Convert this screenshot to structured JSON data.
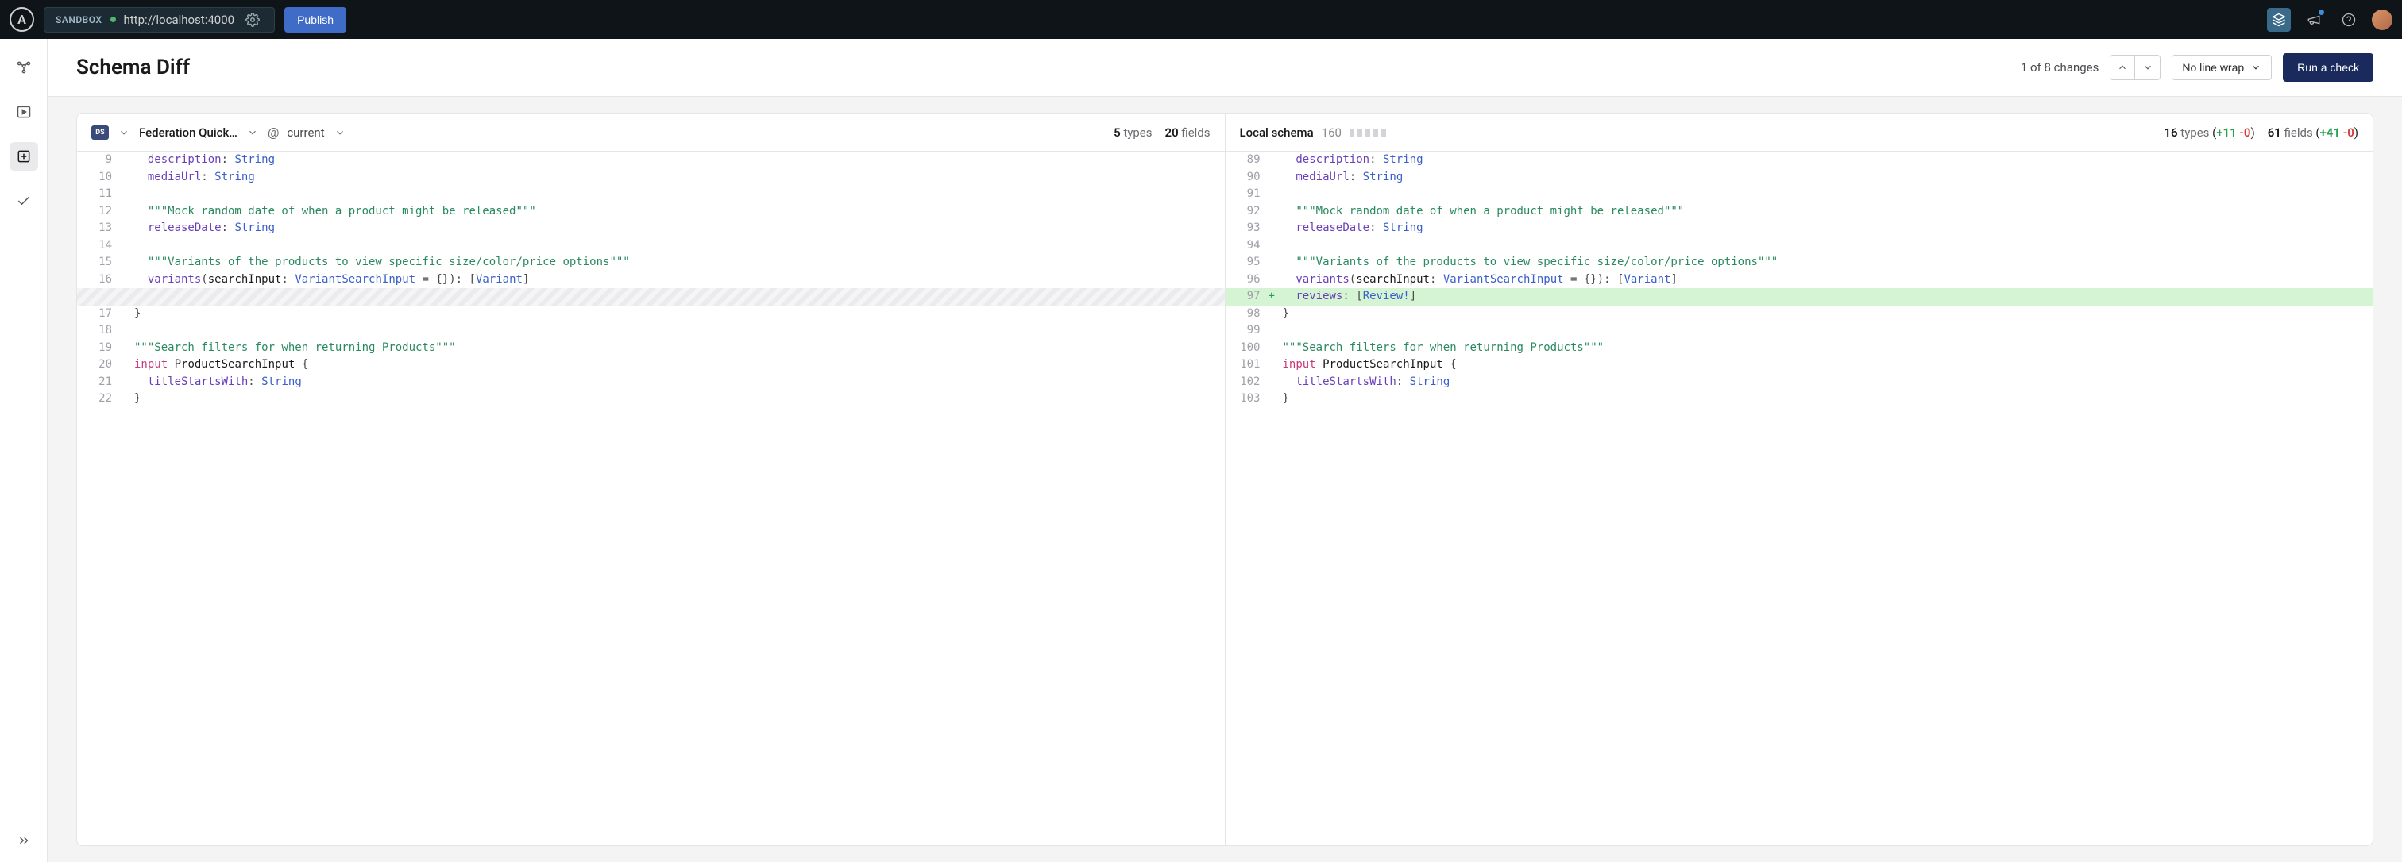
{
  "topbar": {
    "logo": "A",
    "sandbox_label": "SANDBOX",
    "url": "http://localhost:4000",
    "publish": "Publish"
  },
  "page": {
    "title": "Schema Diff",
    "changes_text": "1 of 8 changes",
    "wrap_label": "No line wrap",
    "run_check": "Run a check"
  },
  "left_col": {
    "ds_label": "DS",
    "graph_name": "Federation Quick…",
    "variant": "current",
    "types_count": "5",
    "types_label": "types",
    "fields_count": "20",
    "fields_label": "fields",
    "lines": [
      {
        "n": "9",
        "indent": "  ",
        "field": "description",
        "type": "String"
      },
      {
        "n": "10",
        "indent": "  ",
        "field": "mediaUrl",
        "type": "String"
      },
      {
        "n": "11",
        "blank": true
      },
      {
        "n": "12",
        "indent": "  ",
        "comment": "\"\"\"Mock random date of when a product might be released\"\"\""
      },
      {
        "n": "13",
        "indent": "  ",
        "field": "releaseDate",
        "type": "String"
      },
      {
        "n": "14",
        "blank": true
      },
      {
        "n": "15",
        "indent": "  ",
        "comment": "\"\"\"Variants of the products to view specific size/color/price options\"\"\""
      },
      {
        "n": "16",
        "indent": "  ",
        "variants": true
      },
      {
        "hatched": true
      },
      {
        "n": "17",
        "close": "}"
      },
      {
        "n": "18",
        "blank": true
      },
      {
        "n": "19",
        "comment": "\"\"\"Search filters for when returning Products\"\"\""
      },
      {
        "n": "20",
        "input_def": "ProductSearchInput"
      },
      {
        "n": "21",
        "indent": "  ",
        "field": "titleStartsWith",
        "type": "String"
      },
      {
        "n": "22",
        "close": "}"
      }
    ]
  },
  "right_col": {
    "title": "Local schema",
    "line_count": "160",
    "types_count": "16",
    "types_label": "types",
    "types_add": "+11",
    "types_del": "-0",
    "fields_count": "61",
    "fields_label": "fields",
    "fields_add": "+41",
    "fields_del": "-0",
    "lines": [
      {
        "n": "89",
        "indent": "  ",
        "field": "description",
        "type": "String"
      },
      {
        "n": "90",
        "indent": "  ",
        "field": "mediaUrl",
        "type": "String"
      },
      {
        "n": "91",
        "blank": true
      },
      {
        "n": "92",
        "indent": "  ",
        "comment": "\"\"\"Mock random date of when a product might be released\"\"\""
      },
      {
        "n": "93",
        "indent": "  ",
        "field": "releaseDate",
        "type": "String"
      },
      {
        "n": "94",
        "blank": true
      },
      {
        "n": "95",
        "indent": "  ",
        "comment": "\"\"\"Variants of the products to view specific size/color/price options\"\"\""
      },
      {
        "n": "96",
        "indent": "  ",
        "variants": true
      },
      {
        "n": "97",
        "mark": "+",
        "added": true,
        "indent": "  ",
        "reviews": true
      },
      {
        "n": "98",
        "close": "}"
      },
      {
        "n": "99",
        "blank": true
      },
      {
        "n": "100",
        "comment": "\"\"\"Search filters for when returning Products\"\"\""
      },
      {
        "n": "101",
        "input_def": "ProductSearchInput"
      },
      {
        "n": "102",
        "indent": "  ",
        "field": "titleStartsWith",
        "type": "String"
      },
      {
        "n": "103",
        "close": "}"
      }
    ]
  }
}
